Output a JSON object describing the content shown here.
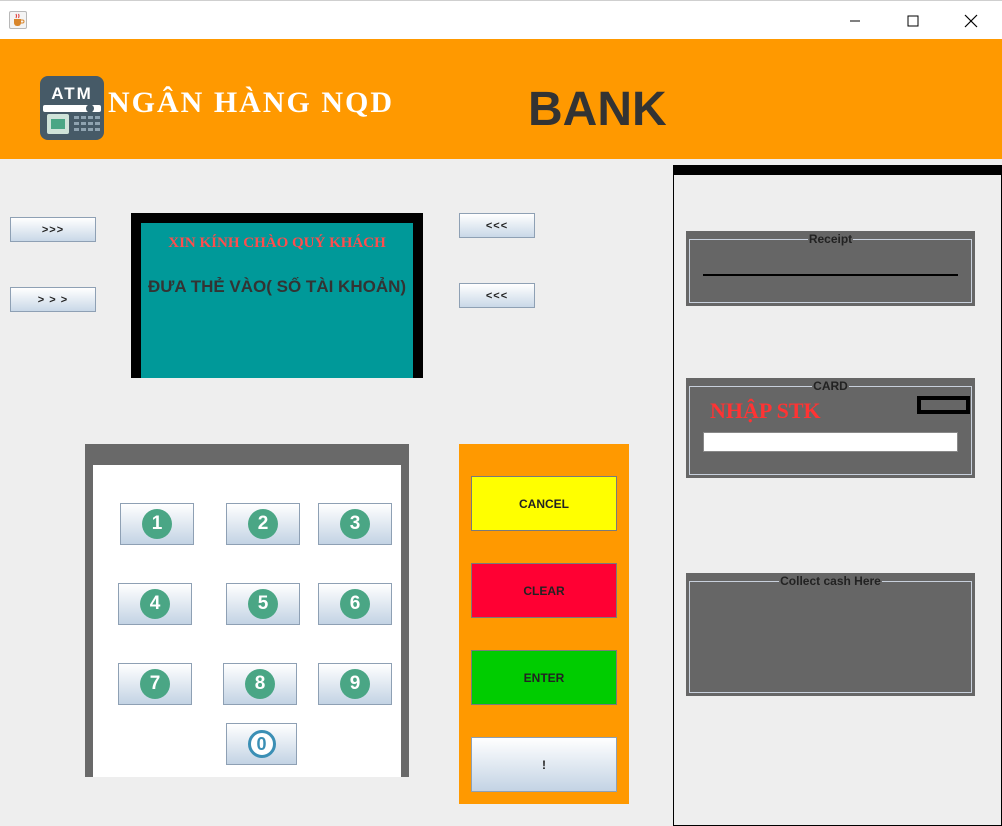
{
  "window": {
    "app_icon": "java-cup-icon",
    "minimize_icon": "minimize-icon",
    "maximize_icon": "maximize-icon",
    "close_icon": "close-icon"
  },
  "header": {
    "logo_text": "ATM",
    "bank_name": "NGÂN HÀNG NQD",
    "bank_word": "BANK",
    "background_color": "#ff9900"
  },
  "side_buttons": {
    "left_top": ">>>",
    "left_bottom": "> > >",
    "right_top": "<<<",
    "right_bottom": "<<<"
  },
  "screen": {
    "welcome": "XIN KÍNH CHÀO QUÝ KHÁCH",
    "prompt": "ĐƯA THẺ VÀO( SỐ TÀI KHOẢN)",
    "background_color": "#009999"
  },
  "keypad": {
    "keys": [
      "1",
      "2",
      "3",
      "4",
      "5",
      "6",
      "7",
      "8",
      "9",
      "0"
    ]
  },
  "actions": {
    "cancel": "CANCEL",
    "clear": "CLEAR",
    "enter": "ENTER",
    "info": "!",
    "cancel_color": "#ffff00",
    "clear_color": "#ff0033",
    "enter_color": "#00cc00"
  },
  "right_panel": {
    "receipt_title": "Receipt",
    "card_title": "CARD",
    "card_label": "NHẬP STK",
    "card_input_value": "",
    "cash_title": "Collect cash Here"
  }
}
